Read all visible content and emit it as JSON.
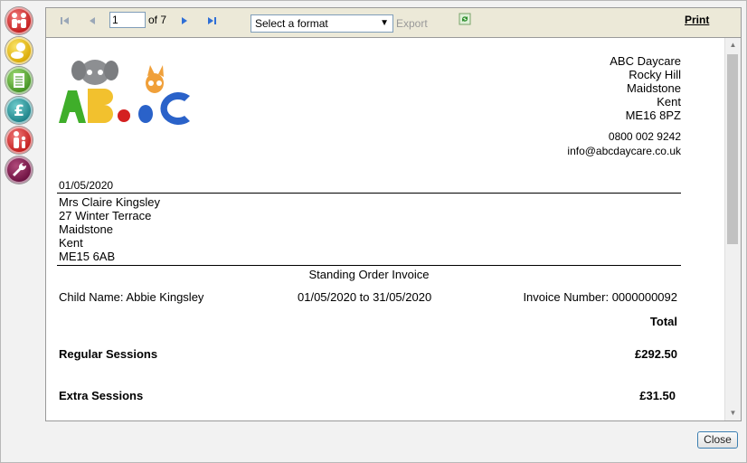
{
  "toolbar": {
    "page_value": "1",
    "page_of": "of 7",
    "format_placeholder": "Select a format",
    "export_label": "Export",
    "print_label": "Print"
  },
  "document": {
    "company": {
      "name": "ABC Daycare",
      "line2": "Rocky Hill",
      "town": "Maidstone",
      "county": "Kent",
      "postcode": "ME16 8PZ",
      "phone": "0800 002 9242",
      "email": "info@abcdaycare.co.uk"
    },
    "date": "01/05/2020",
    "recipient": {
      "name": "Mrs Claire Kingsley",
      "street": "27 Winter Terrace",
      "town": "Maidstone",
      "county": "Kent",
      "postcode": "ME15 6AB"
    },
    "invoice_title": "Standing Order Invoice",
    "child_name": "Child Name: Abbie Kingsley",
    "period": "01/05/2020 to 31/05/2020",
    "invoice_number": "Invoice Number: 0000000092",
    "total_header": "Total",
    "rows": [
      {
        "label": "Regular Sessions",
        "amount": "£292.50"
      },
      {
        "label": "Extra Sessions",
        "amount": "£31.50"
      }
    ]
  },
  "close_label": "Close",
  "icons": {
    "nav": [
      "family-icon",
      "baby-icon",
      "notepad-icon",
      "pound-icon",
      "parent-child-icon",
      "wrench-icon"
    ]
  }
}
